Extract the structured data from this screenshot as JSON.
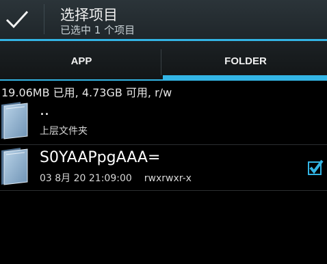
{
  "actionbar": {
    "title": "选择项目",
    "subtitle": "已选中 1 个项目"
  },
  "tabs": [
    {
      "label": "APP",
      "selected": false
    },
    {
      "label": "FOLDER",
      "selected": true
    }
  ],
  "storage": {
    "summary": "19.06MB 已用, 4.73GB 可用, r/w"
  },
  "list": [
    {
      "name": "..",
      "detail": "上层文件夹",
      "icon": "folder-icon"
    },
    {
      "name": "S0YAAPpgAAA=",
      "date": "03 8月 20 21:09:00",
      "permissions": "rwxrwxr-x",
      "icon": "folder-icon",
      "checked": true
    }
  ],
  "colors": {
    "accent": "#33b5e5",
    "actionbar": "#263238",
    "background": "#000000"
  }
}
